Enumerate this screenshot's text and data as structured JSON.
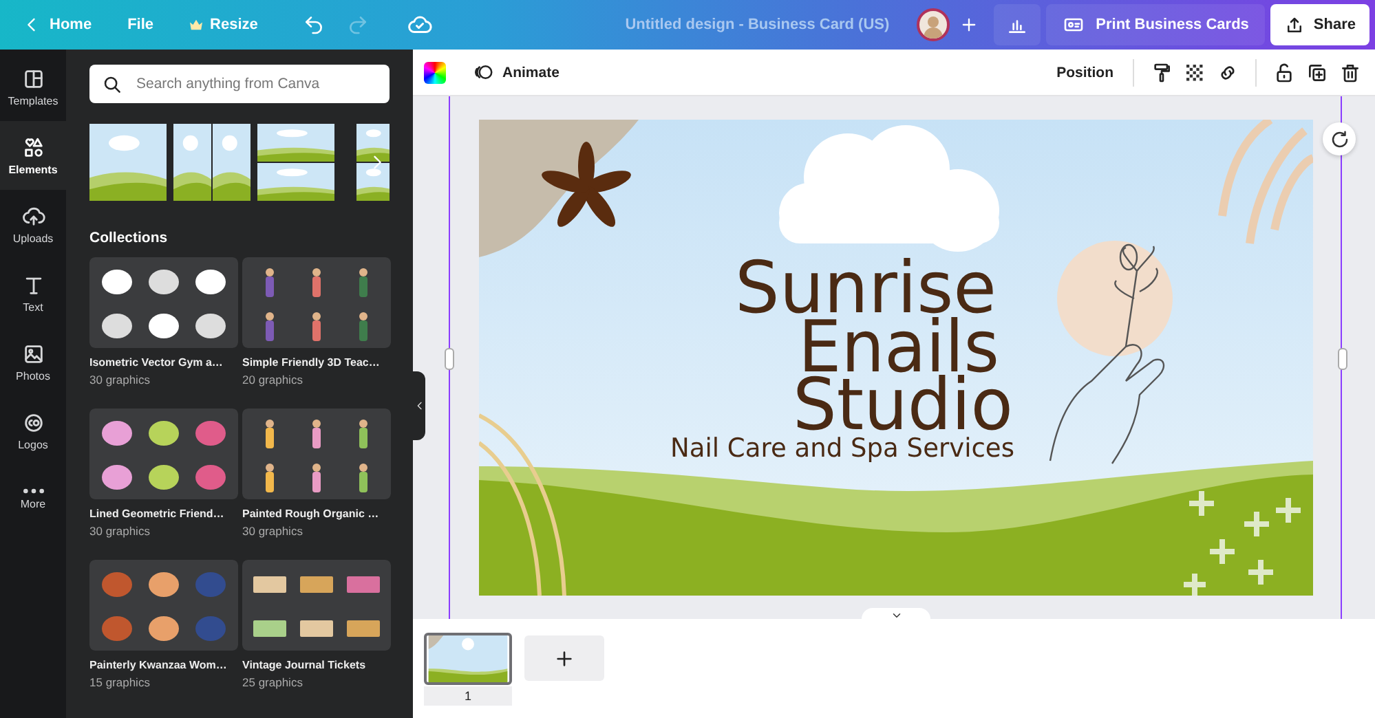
{
  "topbar": {
    "nav": [
      {
        "kind": "home",
        "label": "Home"
      },
      {
        "kind": "file",
        "label": "File"
      },
      {
        "kind": "resize",
        "label": "Resize"
      }
    ],
    "history": [
      {
        "kind": "undo",
        "disabled": false
      },
      {
        "kind": "redo",
        "disabled": true
      }
    ],
    "title": "Untitled design - Business Card (US)",
    "print_button": "Print Business Cards",
    "share_button": "Share"
  },
  "sidebar": {
    "items": [
      {
        "kind": "templates",
        "label": "Templates",
        "selected": false
      },
      {
        "kind": "elements",
        "label": "Elements",
        "selected": true
      },
      {
        "kind": "uploads",
        "label": "Uploads",
        "selected": false
      },
      {
        "kind": "text",
        "label": "Text",
        "selected": false
      },
      {
        "kind": "photos",
        "label": "Photos",
        "selected": false
      },
      {
        "kind": "logos",
        "label": "Logos",
        "selected": false
      },
      {
        "kind": "more",
        "label": "More",
        "selected": false
      }
    ]
  },
  "panel": {
    "search": {
      "placeholder": "Search anything from Canva"
    },
    "collections_heading": "Collections",
    "collections": [
      {
        "name": "Isometric Vector Gym a…",
        "count": "30 graphics"
      },
      {
        "name": "Simple Friendly 3D Teac…",
        "count": "20 graphics"
      },
      {
        "name": "Lined Geometric Friend…",
        "count": "30 graphics"
      },
      {
        "name": "Painted Rough Organic …",
        "count": "30 graphics"
      },
      {
        "name": "Painterly Kwanzaa Wom…",
        "count": "15 graphics"
      },
      {
        "name": "Vintage Journal Tickets",
        "count": "25 graphics"
      }
    ]
  },
  "toolbar": {
    "animate": "Animate",
    "position": "Position"
  },
  "design": {
    "headline": [
      "Sunrise",
      "Enails",
      "Studio"
    ],
    "tagline": "Nail Care and Spa Services"
  },
  "pages": [
    {
      "number": "1",
      "selected": true
    }
  ]
}
